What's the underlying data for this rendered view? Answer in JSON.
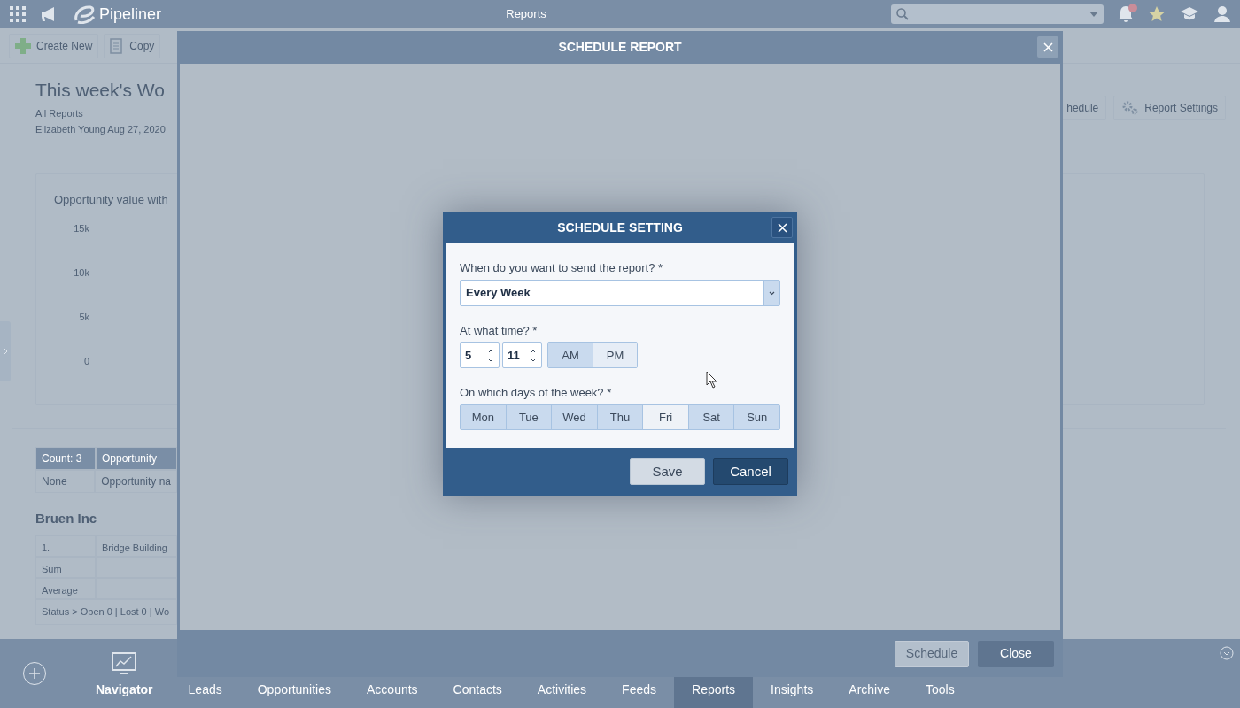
{
  "top_bar": {
    "logo": "Pipeliner",
    "title": "Reports",
    "notification_badge": true
  },
  "toolbar": {
    "buttons": [
      "Create New",
      "Copy"
    ]
  },
  "report": {
    "title": "This week's Wo",
    "breadcrumb": "All Reports",
    "meta": "Elizabeth Young Aug 27, 2020",
    "actions": [
      "hedule",
      "Report Settings"
    ]
  },
  "chart": {
    "title": "Opportunity value with",
    "y_labels": [
      "15k",
      "10k",
      "5k",
      "0"
    ]
  },
  "summary_table": {
    "columns": [
      "Count: 3",
      "Opportunity"
    ],
    "rows": [
      [
        "None",
        "Opportunity na"
      ]
    ]
  },
  "group": {
    "title": "Bruen Inc",
    "rows": [
      [
        "1.",
        "Bridge Building"
      ],
      [
        "Sum"
      ],
      [
        "Average"
      ]
    ],
    "footer": "Status > Open 0 | Lost 0 | Wo"
  },
  "bottom_nav": {
    "items": [
      {
        "label": "Navigator",
        "selected": false
      },
      {
        "label": "Leads",
        "selected": false
      },
      {
        "label": "Opportunities",
        "selected": false
      },
      {
        "label": "Accounts",
        "selected": false
      },
      {
        "label": "Contacts",
        "selected": false
      },
      {
        "label": "Activities",
        "selected": false
      },
      {
        "label": "Feeds",
        "selected": false
      },
      {
        "label": "Reports",
        "selected": true
      },
      {
        "label": "Insights",
        "selected": false
      },
      {
        "label": "Archive",
        "selected": false
      },
      {
        "label": "Tools",
        "selected": false
      }
    ]
  },
  "schedule_report_dialog": {
    "title": "SCHEDULE REPORT",
    "buttons": [
      {
        "label": "Schedule",
        "disabled": true
      },
      {
        "label": "Close",
        "disabled": false
      }
    ]
  },
  "schedule_setting_dialog": {
    "title": "SCHEDULE SETTING",
    "frequency": {
      "label": "When do you want to send the report? *",
      "value": "Every Week"
    },
    "time": {
      "label": "At what time? *",
      "hour": "5",
      "minute": "11",
      "periods": [
        {
          "label": "AM",
          "selected": true
        },
        {
          "label": "PM",
          "selected": false
        }
      ]
    },
    "days": {
      "label": "On which days of the week? *",
      "items": [
        {
          "label": "Mon",
          "selected": true
        },
        {
          "label": "Tue",
          "selected": true
        },
        {
          "label": "Wed",
          "selected": true
        },
        {
          "label": "Thu",
          "selected": true
        },
        {
          "label": "Fri",
          "selected": false
        },
        {
          "label": "Sat",
          "selected": true
        },
        {
          "label": "Sun",
          "selected": true
        }
      ]
    },
    "buttons": [
      {
        "label": "Save",
        "kind": "secondary"
      },
      {
        "label": "Cancel",
        "kind": "primary"
      }
    ]
  }
}
